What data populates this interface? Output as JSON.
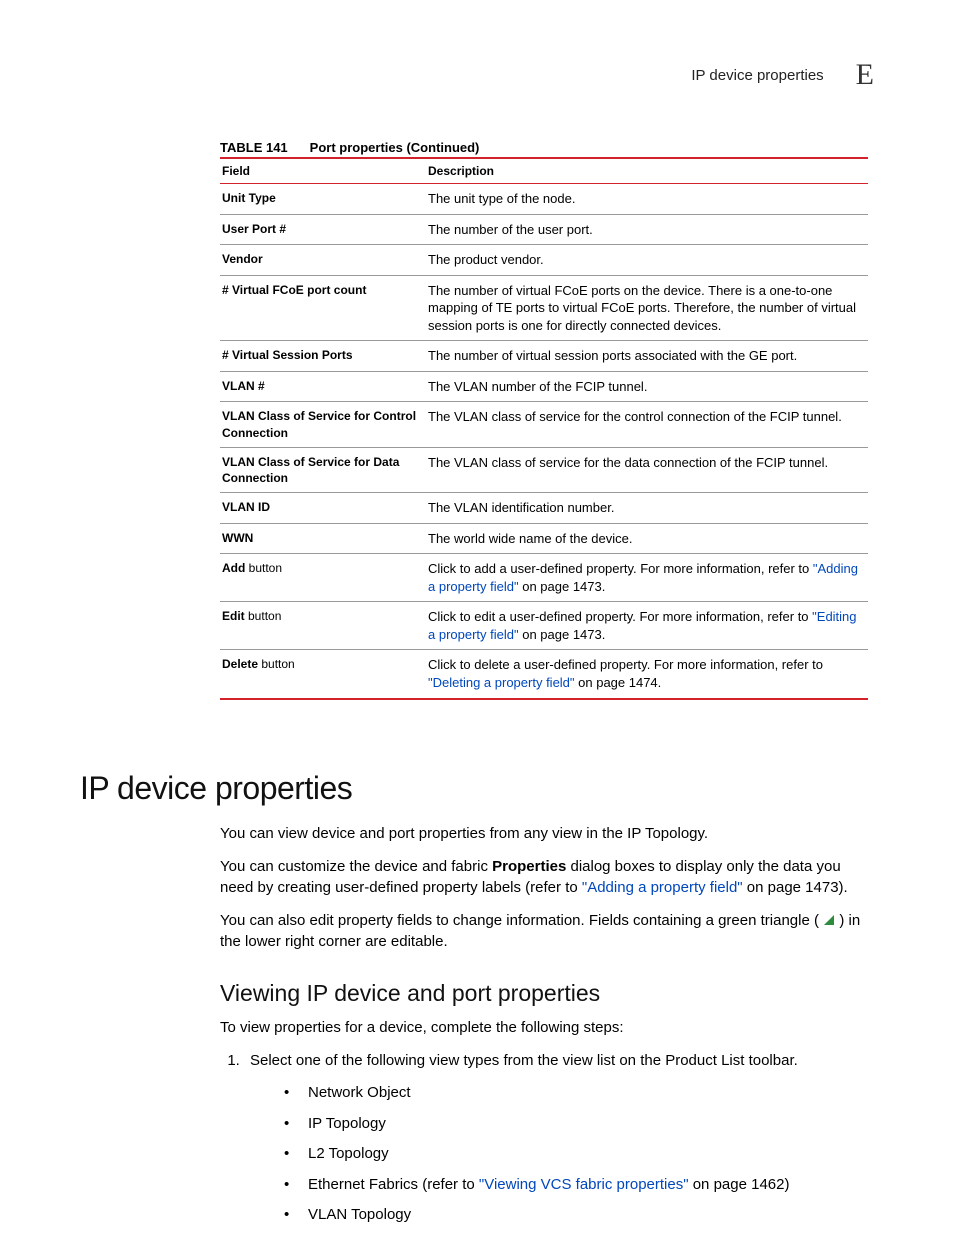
{
  "header": {
    "title": "IP device properties",
    "appendix": "E"
  },
  "table": {
    "caption_num": "TABLE 141",
    "caption_title": "Port properties (Continued)",
    "col_field": "Field",
    "col_desc": "Description",
    "rows": {
      "unit_type": {
        "f": "Unit Type",
        "d": "The unit type of the node."
      },
      "user_port": {
        "f": "User Port #",
        "d": "The number of the user port."
      },
      "vendor": {
        "f": "Vendor",
        "d": "The product vendor."
      },
      "vfcoe": {
        "f": "# Virtual FCoE port count",
        "d": "The number of virtual FCoE ports on the device. There is a one-to-one mapping of TE ports to virtual FCoE ports. Therefore, the number of virtual session ports is one for directly connected devices."
      },
      "vsp": {
        "f": "# Virtual Session Ports",
        "d": "The number of virtual session ports associated with the GE port."
      },
      "vlan_num": {
        "f": "VLAN #",
        "d": "The VLAN number of the FCIP tunnel."
      },
      "vlan_cos_ctrl": {
        "f": "VLAN Class of Service for Control Connection",
        "d": "The VLAN class of service for the control connection of the FCIP tunnel."
      },
      "vlan_cos_data": {
        "f": "VLAN Class of Service for Data Connection",
        "d": "The VLAN class of service for the data connection of the FCIP tunnel."
      },
      "vlan_id": {
        "f": "VLAN ID",
        "d": "The VLAN identification number."
      },
      "wwn": {
        "f": "WWN",
        "d": "The world wide name of the device."
      },
      "add": {
        "f_bold": "Add",
        "f_rest": " button",
        "pre": "Click to add a user-defined property. For more information, refer to ",
        "link": "\"Adding a property field\"",
        "post": " on page 1473."
      },
      "edit": {
        "f_bold": "Edit",
        "f_rest": " button",
        "pre": "Click to edit a user-defined property. For more information, refer to ",
        "link": "\"Editing a property field\"",
        "post": " on page 1473."
      },
      "delete": {
        "f_bold": "Delete",
        "f_rest": " button",
        "pre": "Click to delete a user-defined property. For more information, refer to ",
        "link": "\"Deleting a property field\"",
        "post": " on page 1474."
      }
    }
  },
  "h1": "IP device properties",
  "p1": "You can view device and port properties from any view in the IP Topology.",
  "p2": {
    "a": "You can customize the device and fabric ",
    "b": "Properties",
    "c": " dialog boxes to display only the data you need by creating user-defined property labels (refer to ",
    "link": "\"Adding a property field\"",
    "d": " on page 1473)."
  },
  "p3": {
    "a": "You can also edit property fields to change information. Fields containing a green triangle ( ",
    "b": " ) in the lower right corner are editable."
  },
  "h2": "Viewing IP device and port properties",
  "p4": "To view properties for a device, complete the following steps:",
  "step1": "Select one of the following view types from the view list on the Product List toolbar.",
  "bullets": {
    "b1": "Network Object",
    "b2": "IP Topology",
    "b3": "L2 Topology",
    "b4a": "Ethernet Fabrics (refer to ",
    "b4link": "\"Viewing VCS fabric properties\"",
    "b4b": " on page 1462)",
    "b5": "VLAN Topology"
  }
}
